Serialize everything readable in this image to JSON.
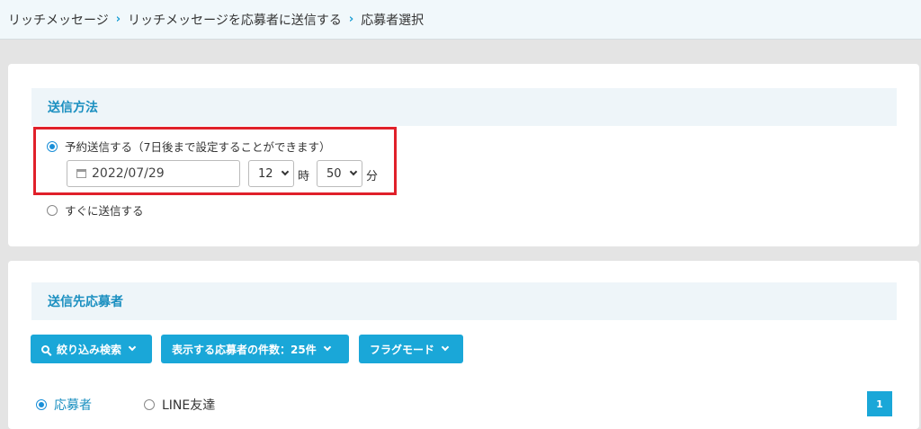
{
  "breadcrumb": {
    "item1": "リッチメッセージ",
    "item2": "リッチメッセージを応募者に送信する",
    "item3": "応募者選択",
    "separator": "›"
  },
  "send_method": {
    "title": "送信方法",
    "scheduled_label": "予約送信する（7日後まで設定することができます）",
    "date_value": "2022/07/29",
    "hour_value": "12",
    "hour_unit": "時",
    "minute_value": "50",
    "minute_unit": "分",
    "immediate_label": "すぐに送信する"
  },
  "recipients": {
    "title": "送信先応募者",
    "filter_button": "絞り込み検索",
    "count_button": "表示する応募者の件数：25件",
    "flag_button": "フラグモード",
    "radio_applicant": "応募者",
    "radio_line": "LINE友達",
    "page_number": "1"
  },
  "colors": {
    "accent": "#1aa7d8",
    "highlight_border": "#e0202a"
  }
}
